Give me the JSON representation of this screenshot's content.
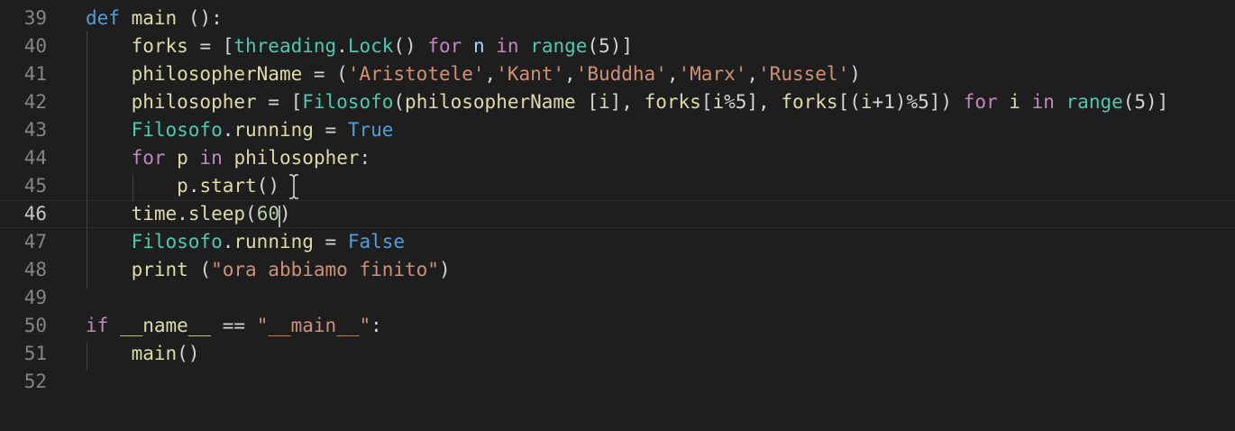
{
  "editor": {
    "language": "python",
    "theme_colors": {
      "background": "#1e1e1e",
      "keyword": "#c586c0",
      "storage": "#569cd6",
      "function": "#dcdcaa",
      "variable": "#9cdcfe",
      "class": "#4ec9b0",
      "string": "#ce9178",
      "number": "#b5cea8",
      "line_number": "#858585"
    },
    "current_line": 46,
    "lines": [
      {
        "number": "39",
        "tokens": [
          {
            "t": "def",
            "c": "def"
          },
          {
            "t": " "
          },
          {
            "t": "main",
            "c": "fn"
          },
          {
            "t": " ():"
          }
        ]
      },
      {
        "number": "40",
        "tokens": [
          {
            "t": "    "
          },
          {
            "t": "forks",
            "c": "fn"
          },
          {
            "t": " = ["
          },
          {
            "t": "threading",
            "c": "cls"
          },
          {
            "t": "."
          },
          {
            "t": "Lock",
            "c": "cls"
          },
          {
            "t": "() "
          },
          {
            "t": "for",
            "c": "kw"
          },
          {
            "t": " "
          },
          {
            "t": "n",
            "c": "var"
          },
          {
            "t": " "
          },
          {
            "t": "in",
            "c": "kw"
          },
          {
            "t": " "
          },
          {
            "t": "range",
            "c": "cls"
          },
          {
            "t": "(5)]"
          }
        ]
      },
      {
        "number": "41",
        "tokens": [
          {
            "t": "    "
          },
          {
            "t": "philosopherName",
            "c": "fn"
          },
          {
            "t": " = ("
          },
          {
            "t": "'Aristotele'",
            "c": "str"
          },
          {
            "t": ","
          },
          {
            "t": "'Kant'",
            "c": "str"
          },
          {
            "t": ","
          },
          {
            "t": "'Buddha'",
            "c": "str"
          },
          {
            "t": ","
          },
          {
            "t": "'Marx'",
            "c": "str"
          },
          {
            "t": ","
          },
          {
            "t": "'Russel'",
            "c": "str"
          },
          {
            "t": ")"
          }
        ]
      },
      {
        "number": "42",
        "tokens": [
          {
            "t": "    "
          },
          {
            "t": "philosopher",
            "c": "fn"
          },
          {
            "t": " = ["
          },
          {
            "t": "Filosofo",
            "c": "cls"
          },
          {
            "t": "("
          },
          {
            "t": "philosopherName",
            "c": "fn"
          },
          {
            "t": " ["
          },
          {
            "t": "i",
            "c": "fn"
          },
          {
            "t": "], "
          },
          {
            "t": "forks",
            "c": "fn"
          },
          {
            "t": "["
          },
          {
            "t": "i",
            "c": "fn"
          },
          {
            "t": "%5], "
          },
          {
            "t": "forks",
            "c": "fn"
          },
          {
            "t": "[("
          },
          {
            "t": "i",
            "c": "fn"
          },
          {
            "t": "+1)%5]) "
          },
          {
            "t": "for",
            "c": "kw"
          },
          {
            "t": " "
          },
          {
            "t": "i",
            "c": "fn"
          },
          {
            "t": " "
          },
          {
            "t": "in",
            "c": "kw"
          },
          {
            "t": " "
          },
          {
            "t": "range",
            "c": "cls"
          },
          {
            "t": "(5)]"
          }
        ]
      },
      {
        "number": "43",
        "tokens": [
          {
            "t": "    "
          },
          {
            "t": "Filosofo",
            "c": "cls"
          },
          {
            "t": "."
          },
          {
            "t": "running",
            "c": "fn"
          },
          {
            "t": " = "
          },
          {
            "t": "True",
            "c": "const"
          }
        ]
      },
      {
        "number": "44",
        "tokens": [
          {
            "t": "    "
          },
          {
            "t": "for",
            "c": "kw"
          },
          {
            "t": " "
          },
          {
            "t": "p",
            "c": "fn"
          },
          {
            "t": " "
          },
          {
            "t": "in",
            "c": "kw"
          },
          {
            "t": " "
          },
          {
            "t": "philosopher",
            "c": "fn"
          },
          {
            "t": ":"
          }
        ]
      },
      {
        "number": "45",
        "tokens": [
          {
            "t": "        "
          },
          {
            "t": "p",
            "c": "fn"
          },
          {
            "t": "."
          },
          {
            "t": "start",
            "c": "fn"
          },
          {
            "t": "()"
          }
        ]
      },
      {
        "number": "46",
        "tokens": [
          {
            "t": "    "
          },
          {
            "t": "time",
            "c": "fn"
          },
          {
            "t": "."
          },
          {
            "t": "sleep",
            "c": "fn"
          },
          {
            "t": "("
          },
          {
            "t": "60",
            "c": "num"
          },
          {
            "t": ")"
          }
        ]
      },
      {
        "number": "47",
        "tokens": [
          {
            "t": "    "
          },
          {
            "t": "Filosofo",
            "c": "cls"
          },
          {
            "t": "."
          },
          {
            "t": "running",
            "c": "fn"
          },
          {
            "t": " = "
          },
          {
            "t": "False",
            "c": "const"
          }
        ]
      },
      {
        "number": "48",
        "tokens": [
          {
            "t": "    "
          },
          {
            "t": "print",
            "c": "fn"
          },
          {
            "t": " ("
          },
          {
            "t": "\"ora abbiamo finito\"",
            "c": "str"
          },
          {
            "t": ")"
          }
        ]
      },
      {
        "number": "49",
        "tokens": []
      },
      {
        "number": "50",
        "tokens": [
          {
            "t": "if",
            "c": "kw"
          },
          {
            "t": " "
          },
          {
            "t": "__name__",
            "c": "fn"
          },
          {
            "t": " == "
          },
          {
            "t": "\"__main__\"",
            "c": "str"
          },
          {
            "t": ":"
          }
        ]
      },
      {
        "number": "51",
        "tokens": [
          {
            "t": "    "
          },
          {
            "t": "main",
            "c": "fn"
          },
          {
            "t": "()"
          }
        ]
      },
      {
        "number": "52",
        "tokens": []
      }
    ]
  }
}
